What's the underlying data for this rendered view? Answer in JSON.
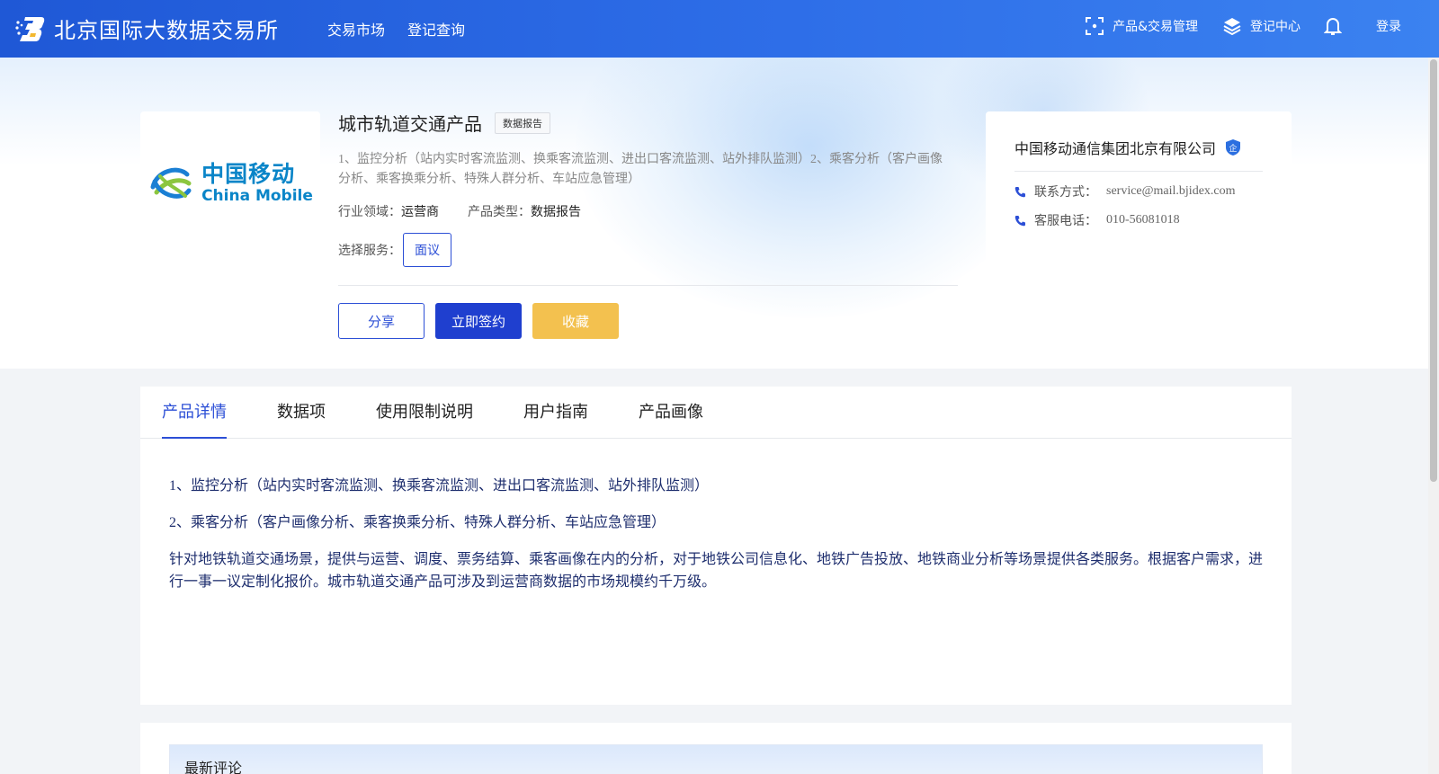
{
  "header": {
    "brand": "北京国际大数据交易所",
    "nav": [
      "交易市场",
      "登记查询"
    ],
    "right": {
      "product_mgmt": "产品&交易管理",
      "registry": "登记中心",
      "login": "登录"
    }
  },
  "product": {
    "logo": {
      "cn": "中国移动",
      "en": "China Mobile"
    },
    "title": "城市轨道交通产品",
    "tag": "数据报告",
    "description": "1、监控分析（站内实时客流监测、换乘客流监测、进出口客流监测、站外排队监测）2、乘客分析（客户画像分析、乘客换乘分析、特殊人群分析、车站应急管理）",
    "industry_label": "行业领域：",
    "industry_value": "运营商",
    "type_label": "产品类型：",
    "type_value": "数据报告",
    "service_label": "选择服务：",
    "service_option": "面议",
    "actions": {
      "share": "分享",
      "sign": "立即签约",
      "favorite": "收藏"
    }
  },
  "company": {
    "name": "中国移动通信集团北京有限公司",
    "badge": "企",
    "contact_label": "联系方式：",
    "contact_value": "service@mail.bjidex.com",
    "phone_label": "客服电话：",
    "phone_value": "010-56081018"
  },
  "tabs": [
    "产品详情",
    "数据项",
    "使用限制说明",
    "用户指南",
    "产品画像"
  ],
  "active_tab": 0,
  "detail": {
    "line1": "1、监控分析（站内实时客流监测、换乘客流监测、进出口客流监测、站外排队监测）",
    "line2": "2、乘客分析（客户画像分析、乘客换乘分析、特殊人群分析、车站应急管理）",
    "line3": "针对地铁轨道交通场景，提供与运营、调度、票务结算、乘客画像在内的分析，对于地铁公司信息化、地铁广告投放、地铁商业分析等场景提供各类服务。根据客户需求，进行一事一议定制化报价。城市轨道交通产品可涉及到运营商数据的市场规模约千万级。"
  },
  "comments": {
    "title": "最新评论"
  },
  "colors": {
    "brand_blue": "#1f58d6",
    "accent": "#2c4fd6",
    "favorite": "#f3c14f"
  }
}
